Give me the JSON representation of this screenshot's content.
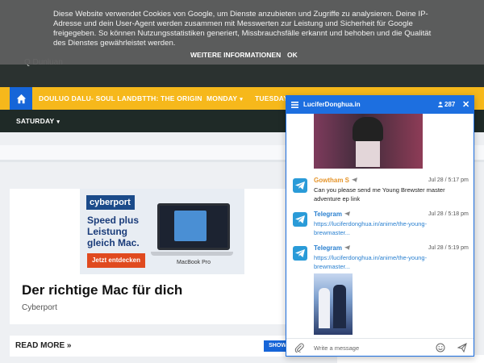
{
  "cookie_notice": {
    "text": "Diese Website verwendet Cookies von Google, um Dienste anzubieten und Zugriffe zu analysieren. Deine IP-Adresse und dein User-Agent werden zusammen mit Messwerten zur Leistung und Sicherheit für Google freigegeben. So können Nutzungsstatistiken generiert, Missbrauchsfälle erkannt und behoben und die Qualität des Dienstes gewährleistet werden.",
    "more_info": "WEITERE INFORMATIONEN",
    "ok": "OK"
  },
  "header": {
    "partial_text": "Q Dunluan"
  },
  "nav": {
    "items": [
      {
        "label": "DOULUO DALU- SOUL LAND"
      },
      {
        "label": "BTTH: THE ORIGIN"
      },
      {
        "label": "MONDAY"
      },
      {
        "label": "TUESDAY"
      }
    ],
    "sub_items": [
      {
        "label": "SATURDAY"
      }
    ]
  },
  "ad": {
    "brand_logo": "cyberport",
    "headline": "Speed plus Leistung gleich Mac.",
    "cta": "Jetzt entdecken",
    "product_label": "MacBook Pro",
    "title": "Der richtige Mac für dich",
    "brand": "Cyberport"
  },
  "read_more": {
    "label": "READ MORE »",
    "show_button": "SHOW"
  },
  "chat": {
    "title": "LuciferDonghua.in",
    "online_count": "287",
    "close": "✕",
    "messages": [
      {
        "author": "Gowtham S",
        "time": "Jul 28 / 5:17 pm",
        "text": "Can you please send me Young Brewster master adventure ep link"
      },
      {
        "author": "Telegram",
        "time": "Jul 28 / 5:18 pm",
        "link": "https://luciferdonghua.in/anime/the-young-brewmaster..."
      },
      {
        "author": "Telegram",
        "time": "Jul 28 / 5:19 pm",
        "link": "https://luciferdonghua.in/anime/the-young-brewmaster..."
      }
    ],
    "input_placeholder": "Write a message"
  },
  "colors": {
    "nav_yellow": "#f6b81b",
    "home_blue": "#1665d8",
    "chat_blue": "#1d6fe0",
    "telegram_blue": "#2a9bd8",
    "author_orange": "#e5952c"
  }
}
